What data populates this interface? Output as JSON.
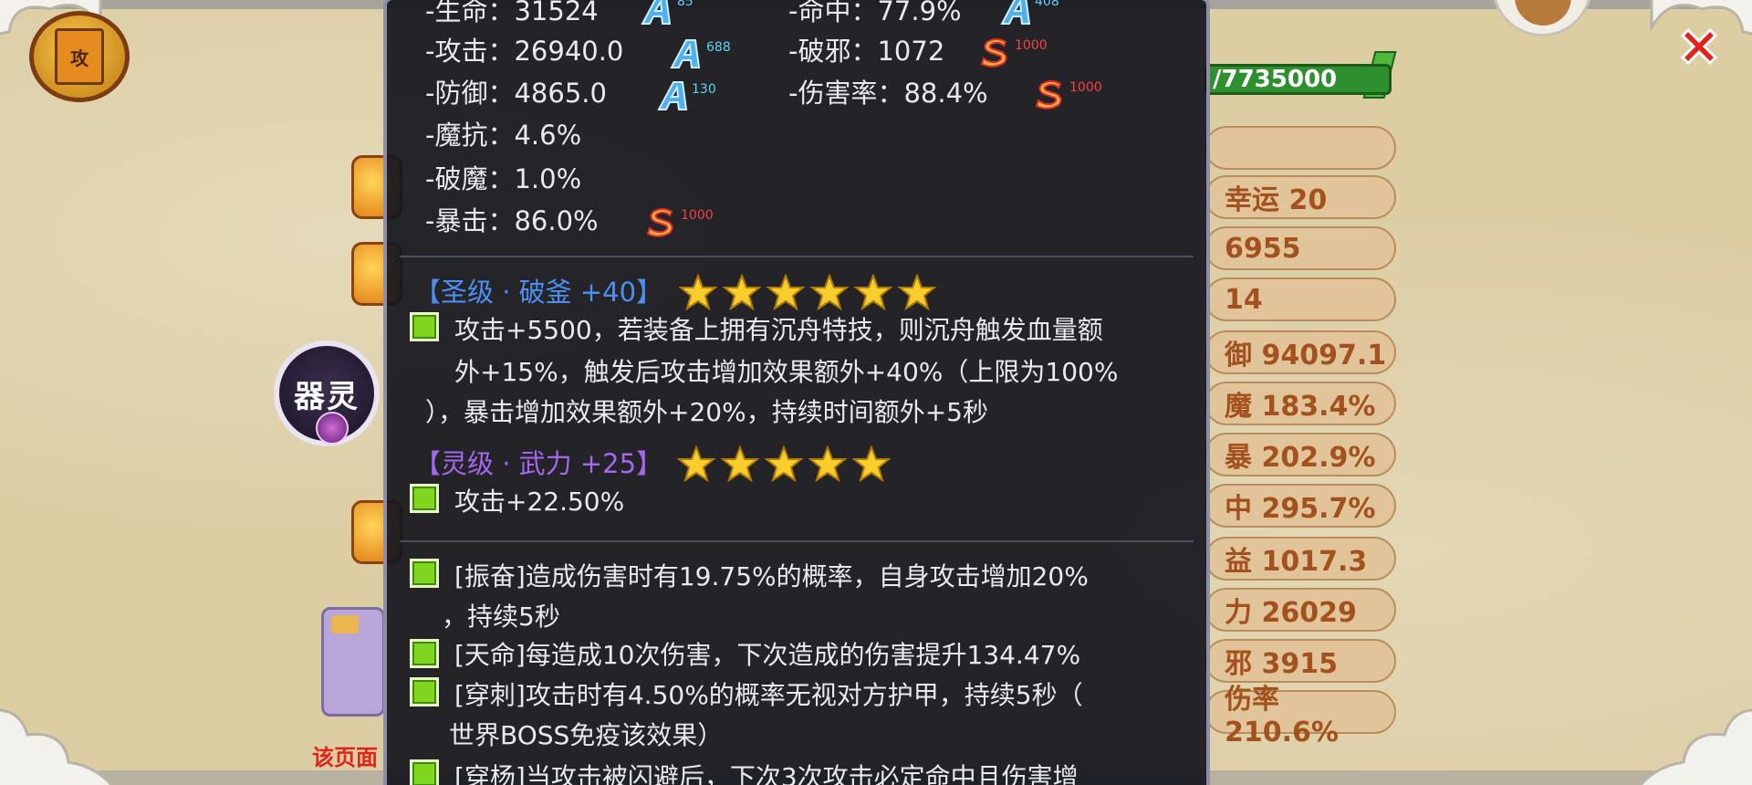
{
  "background": {
    "book_icon_char": "攻",
    "page_hint": "该页面",
    "hp_value": "/7735000",
    "bar_values": [
      "",
      "幸运 20",
      "6955",
      "14",
      "御 94097.1",
      "魔 183.4%",
      "暴 202.9%",
      "中 295.7%",
      "益 1017.3",
      "力 26029",
      "邪 3915",
      "伤率 210.6%"
    ]
  },
  "qiling_badge": {
    "label": "器灵"
  },
  "stats": {
    "left": [
      {
        "label": "-生命：31524",
        "badge": "A",
        "badge_num": "85"
      },
      {
        "label": "-攻击：26940.0",
        "badge": "A",
        "badge_num": "688"
      },
      {
        "label": "-防御：4865.0",
        "badge": "A",
        "badge_num": "130"
      },
      {
        "label": "-魔抗：4.6%"
      },
      {
        "label": "-破魔：1.0%"
      },
      {
        "label": "-暴击：86.0%",
        "badge": "S",
        "badge_num": "1000"
      }
    ],
    "right": [
      {
        "label": "-命中：77.9%",
        "badge": "A",
        "badge_num": "408"
      },
      {
        "label": "-破邪：1072",
        "badge": "S",
        "badge_num": "1000"
      },
      {
        "label": "-伤害率：88.4%",
        "badge": "S",
        "badge_num": "1000"
      }
    ]
  },
  "sets": [
    {
      "title": "【圣级 · 破釜 +40】",
      "color": "#4d8ff0",
      "stars": 6,
      "lines": [
        "攻击+5500，若装备上拥有沉舟特技，则沉舟触发血量额",
        "外+15%，触发后攻击增加效果额外+40%（上限为100%",
        "），暴击增加效果额外+20%，持续时间额外+5秒"
      ]
    },
    {
      "title": "【灵级 · 武力 +25】",
      "color": "#a467ee",
      "stars": 5,
      "lines": [
        "攻击+22.50%"
      ]
    }
  ],
  "skills": [
    {
      "lines": [
        "[振奋]造成伤害时有19.75%的概率，自身攻击增加20%",
        "，持续5秒"
      ]
    },
    {
      "lines": [
        "[天命]每造成10次伤害，下次造成的伤害提升134.47%"
      ]
    },
    {
      "lines": [
        "[穿刺]攻击时有4.50%的概率无视对方护甲，持续5秒（",
        "世界BOSS免疫该效果）"
      ]
    },
    {
      "lines": [
        "[穿杨]当攻击被闪避后，下次3次攻击必定命中且伤害增"
      ]
    }
  ]
}
